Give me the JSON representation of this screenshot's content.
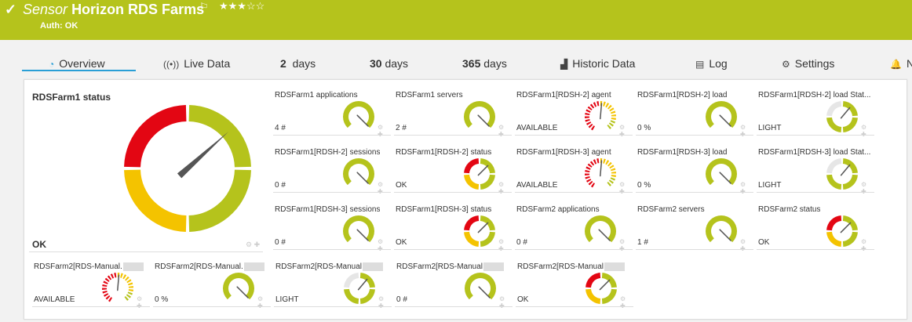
{
  "header": {
    "status_icon": "check-icon",
    "kind": "Sensor",
    "name": "Horizon RDS Farms",
    "flag_icon": "flag-icon",
    "stars": "★★★☆☆",
    "rating": 3,
    "auth": "Auth: OK",
    "color": "#b5c31c"
  },
  "tabs": [
    {
      "icon": "overview-gauge-icon",
      "label": "Overview"
    },
    {
      "icon": "live-data-icon",
      "label": "Live Data"
    },
    {
      "num": "2",
      "label": "days"
    },
    {
      "num": "30",
      "label": "days"
    },
    {
      "num": "365",
      "label": "days"
    },
    {
      "icon": "chart-icon",
      "label": "Historic Data"
    },
    {
      "icon": "log-icon",
      "label": "Log"
    },
    {
      "icon": "gear-icon",
      "label": "Settings"
    },
    {
      "icon": "bell-icon",
      "label": "N"
    }
  ],
  "main_gauge": {
    "title": "RDSFarm1 status",
    "value": "OK"
  },
  "colors": {
    "red": "#e30613",
    "yellow": "#f4c300",
    "green": "#b5c31c",
    "grey": "#e6e6e6"
  },
  "tiles": [
    {
      "label": "RDSFarm1 applications",
      "value": "4 #"
    },
    {
      "label": "RDSFarm1 servers",
      "value": "2 #"
    },
    {
      "label": "RDSFarm1[RDSH-2] agent",
      "value": "AVAILABLE"
    },
    {
      "label": "RDSFarm1[RDSH-2] load",
      "value": "0 %"
    },
    {
      "label": "RDSFarm1[RDSH-2] load Stat...",
      "value": "LIGHT"
    },
    {
      "label": "RDSFarm1[RDSH-2] sessions",
      "value": "0 #"
    },
    {
      "label": "RDSFarm1[RDSH-2] status",
      "value": "OK"
    },
    {
      "label": "RDSFarm1[RDSH-3] agent",
      "value": "AVAILABLE"
    },
    {
      "label": "RDSFarm1[RDSH-3] load",
      "value": "0 %"
    },
    {
      "label": "RDSFarm1[RDSH-3] load Stat...",
      "value": "LIGHT"
    },
    {
      "label": "RDSFarm1[RDSH-3] sessions",
      "value": "0 #"
    },
    {
      "label": "RDSFarm1[RDSH-3] status",
      "value": "OK"
    },
    {
      "label": "RDSFarm2 applications",
      "value": "0 #"
    },
    {
      "label": "RDSFarm2 servers",
      "value": "1 #"
    },
    {
      "label": "RDSFarm2 status",
      "value": "OK"
    },
    {
      "label": "RDSFarm2[RDS-Manual.",
      "value": "AVAILABLE"
    },
    {
      "label": "RDSFarm2[RDS-Manual.",
      "value": "0 %"
    },
    {
      "label": "RDSFarm2[RDS-Manual",
      "value": "LIGHT"
    },
    {
      "label": "RDSFarm2[RDS-Manual",
      "value": "0 #"
    },
    {
      "label": "RDSFarm2[RDS-Manual",
      "value": "OK"
    }
  ]
}
